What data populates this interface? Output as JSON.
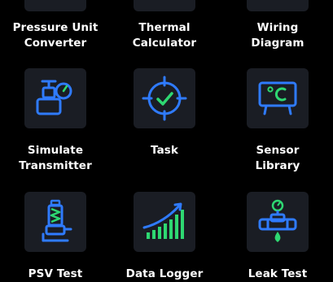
{
  "tools": [
    {
      "label_line1": "Pressure Unit",
      "label_line2": "Converter",
      "icon": "gauge-icon"
    },
    {
      "label_line1": "Thermal",
      "label_line2": "Calculator",
      "icon": "thermometer-icon"
    },
    {
      "label_line1": "Wiring",
      "label_line2": "Diagram",
      "icon": "wiring-icon"
    },
    {
      "label_line1": "Simulate",
      "label_line2": "Transmitter",
      "icon": "valve-gauge-icon"
    },
    {
      "label_line1": "Task",
      "label_line2": "",
      "icon": "target-check-icon"
    },
    {
      "label_line1": "Sensor",
      "label_line2": "Library",
      "icon": "celsius-display-icon"
    },
    {
      "label_line1": "PSV Test",
      "label_line2": "",
      "icon": "safety-valve-icon"
    },
    {
      "label_line1": "Data Logger",
      "label_line2": "",
      "icon": "bar-chart-trend-icon"
    },
    {
      "label_line1": "Leak Test",
      "label_line2": "",
      "icon": "pipe-drop-icon"
    }
  ],
  "colors": {
    "background": "#000000",
    "tile": "#1a1d24",
    "icon_blue": "#2f7bff",
    "icon_green": "#2ed872",
    "label": "#ffffff"
  }
}
